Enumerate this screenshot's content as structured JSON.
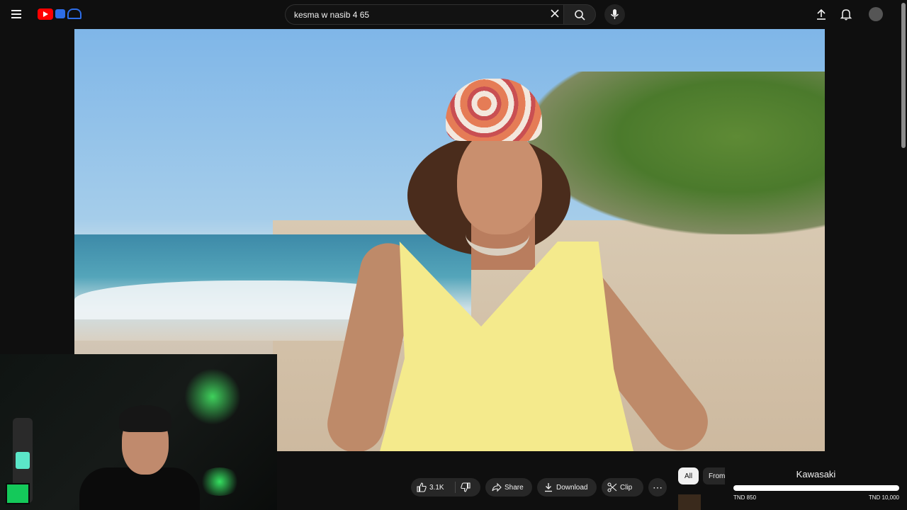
{
  "header": {
    "search_value": "kesma w nasib 4 65",
    "icons": [
      "menu-icon",
      "youtube-logo",
      "clear-icon",
      "search-icon",
      "mic-icon",
      "upload-icon",
      "bell-icon",
      "avatar"
    ]
  },
  "video": {
    "watermark": "—"
  },
  "actions": {
    "like_count": "3.1K",
    "share_label": "Share",
    "download_label": "Download",
    "clip_label": "Clip",
    "more_label": "⋯"
  },
  "chips": {
    "all_label": "All",
    "from_label": "From"
  },
  "overlay": {
    "title": "Kawasaki",
    "min_label": "TND 850",
    "max_label": "TND 10,000",
    "progress_fraction": 1.0
  },
  "colors": {
    "background": "#0f0f0f",
    "surface": "#272727",
    "text": "#f1f1f1",
    "brand_red": "#ff0000"
  }
}
